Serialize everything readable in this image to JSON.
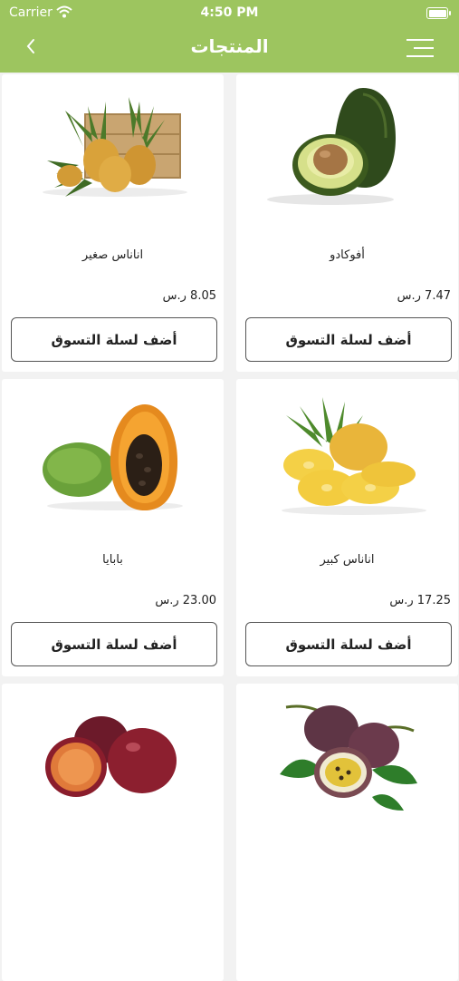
{
  "status_bar": {
    "carrier": "Carrier",
    "time": "4:50 PM"
  },
  "header": {
    "title": "المنتجات"
  },
  "products": [
    {
      "name": "أفوكادو",
      "price": "7.47 ر.س",
      "button": "أضف لسلة التسوق",
      "image": "avocado"
    },
    {
      "name": "اناناس صغير",
      "price": "8.05 ر.س",
      "button": "أضف لسلة التسوق",
      "image": "small-pineapples"
    },
    {
      "name": "اناناس كبير",
      "price": "17.25 ر.س",
      "button": "أضف لسلة التسوق",
      "image": "sliced-pineapple"
    },
    {
      "name": "بابايا",
      "price": "23.00 ر.س",
      "button": "أضف لسلة التسوق",
      "image": "papaya"
    },
    {
      "image": "passion-fruit"
    },
    {
      "image": "plums"
    }
  ]
}
